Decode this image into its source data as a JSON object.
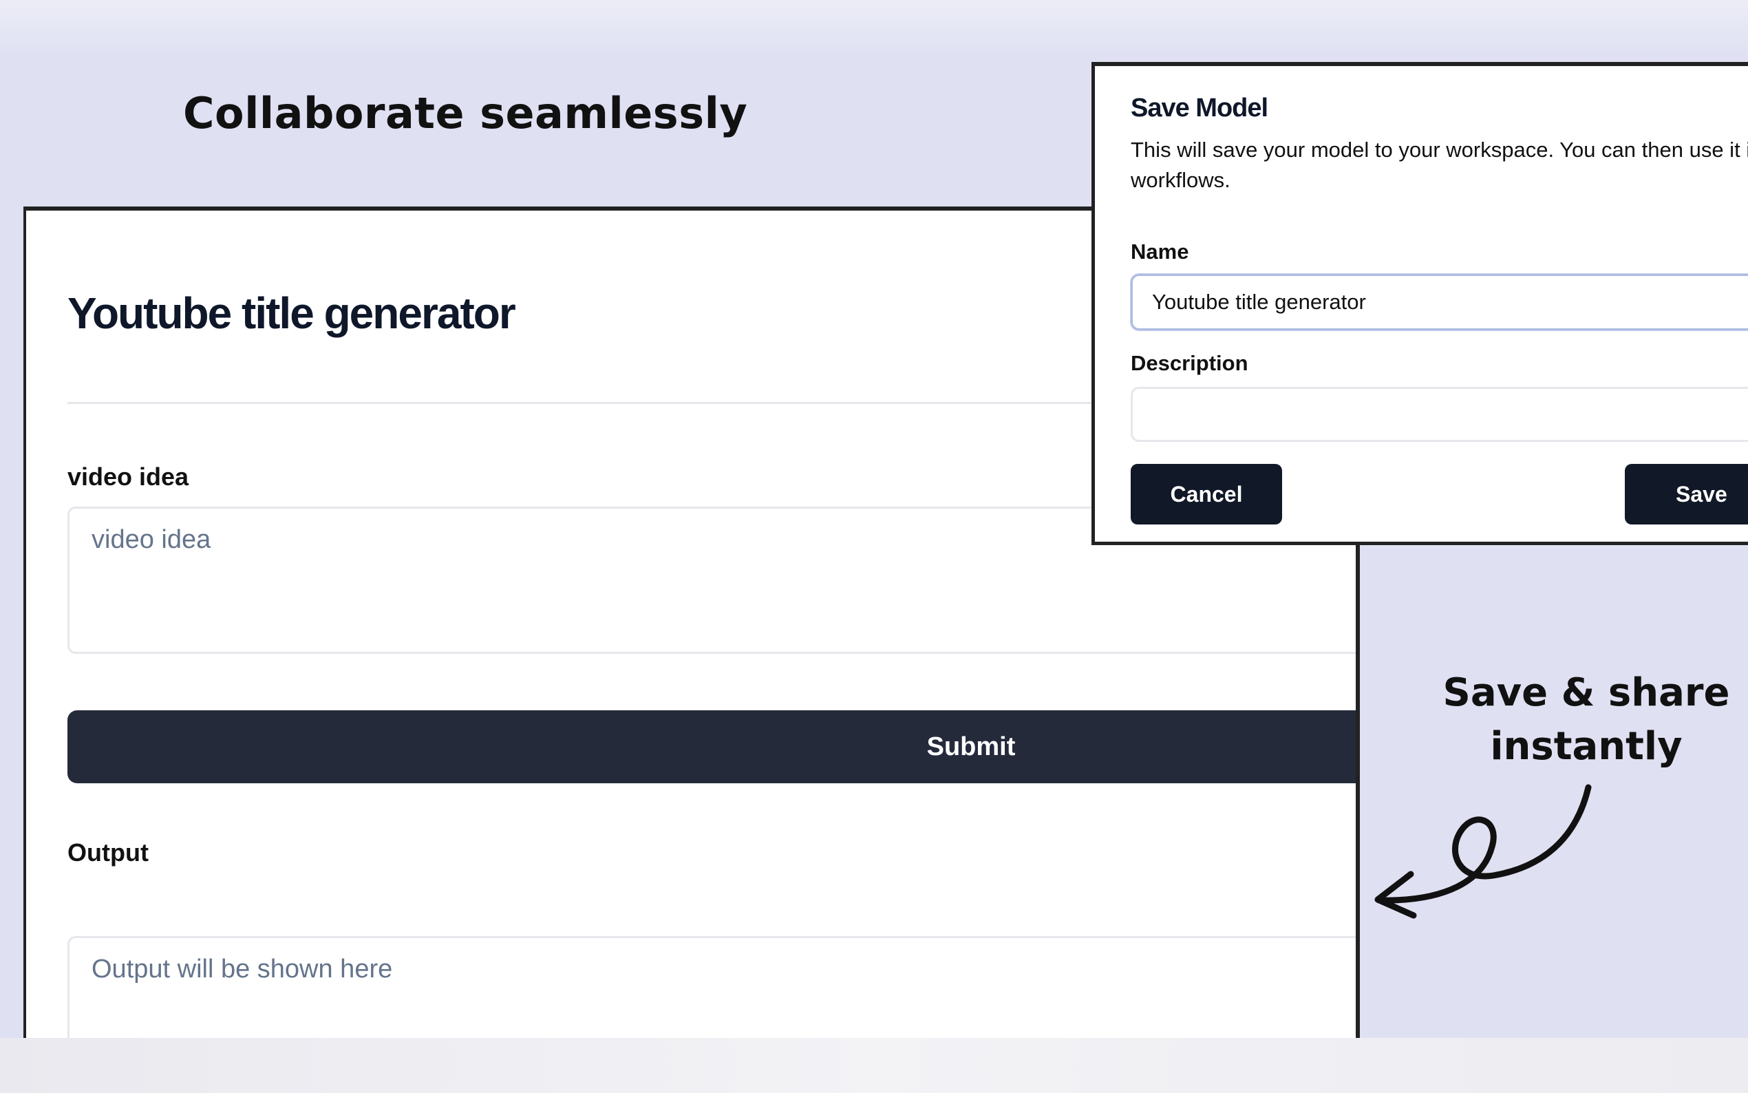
{
  "headline": "Collaborate seamlessly",
  "app": {
    "title": "Youtube title generator",
    "video_idea_label": "video idea",
    "video_idea_placeholder": "video idea",
    "submit_label": "Submit",
    "output_label": "Output",
    "output_placeholder": "Output will be shown here"
  },
  "modal": {
    "title": "Save Model",
    "description": "This will save your model to your workspace. You can then use it in workflows.",
    "name_label": "Name",
    "name_value": "Youtube title generator",
    "description_label": "Description",
    "description_value": "",
    "cancel_label": "Cancel",
    "save_label": "Save"
  },
  "callout": {
    "line1": "Save & share",
    "line2": "instantly",
    "arrow_icon": "curly-arrow-left-icon"
  },
  "colors": {
    "background": "#dfe0f2",
    "button_dark": "#252a3b",
    "modal_button": "#111827",
    "placeholder": "#64748b"
  }
}
